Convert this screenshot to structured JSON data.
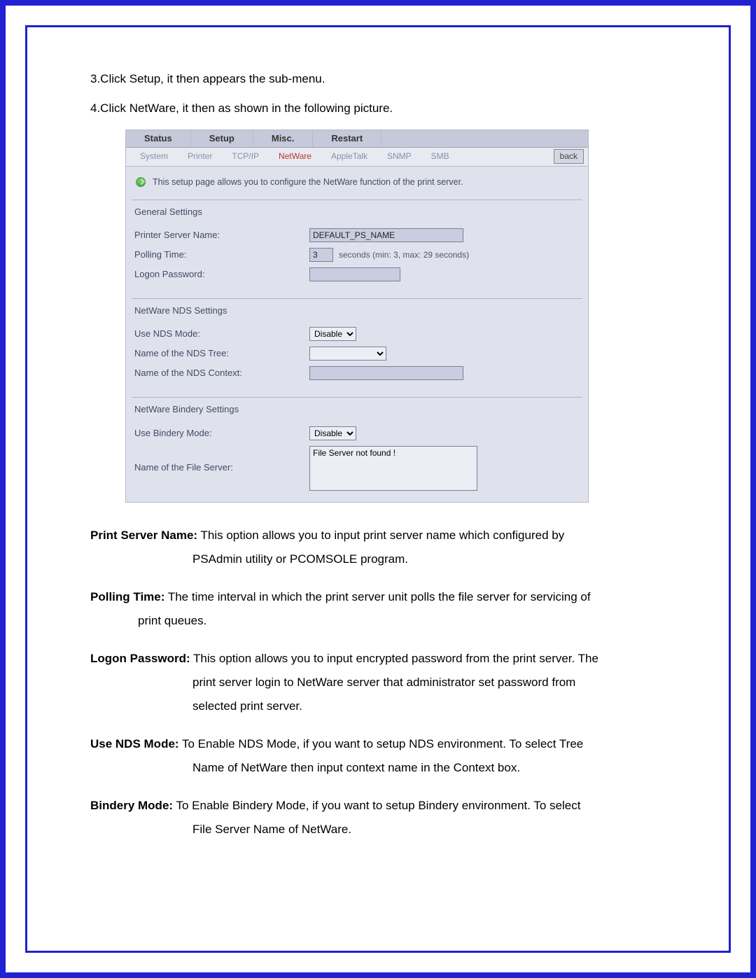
{
  "steps": {
    "s3": "3.Click Setup, it then appears the sub-menu.",
    "s4": "4.Click NetWare, it then as shown in the following picture."
  },
  "ui": {
    "tabs": {
      "status": "Status",
      "setup": "Setup",
      "misc": "Misc.",
      "restart": "Restart"
    },
    "subtabs": {
      "system": "System",
      "printer": "Printer",
      "tcpip": "TCP/IP",
      "netware": "NetWare",
      "appletalk": "AppleTalk",
      "snmp": "SNMP",
      "smb": "SMB"
    },
    "back": "back",
    "desc": "This setup page allows you to configure the NetWare function of the print server.",
    "general": {
      "title": "General Settings",
      "ps_name_label": "Printer Server Name:",
      "ps_name_value": "DEFAULT_PS_NAME",
      "polling_label": "Polling Time:",
      "polling_value": "3",
      "polling_hint": "seconds (min: 3, max: 29 seconds)",
      "logon_label": "Logon Password:",
      "logon_value": ""
    },
    "nds": {
      "title": "NetWare NDS Settings",
      "use_label": "Use NDS Mode:",
      "use_value": "Disable",
      "tree_label": "Name of the NDS Tree:",
      "tree_value": "",
      "ctx_label": "Name of the NDS Context:",
      "ctx_value": ""
    },
    "bindery": {
      "title": "NetWare Bindery Settings",
      "use_label": "Use Bindery Mode:",
      "use_value": "Disable",
      "fs_label": "Name of the File Server:",
      "fs_value": "File Server not found !"
    }
  },
  "defs": {
    "ps_name": {
      "label": "Print Server Name:",
      "l1": " This option allows you to input print server name which configured by",
      "l2": "PSAdmin utility or PCOMSOLE program."
    },
    "polling": {
      "label": "Polling Time:",
      "l1": " The time interval in which the print server unit polls the file server for servicing of",
      "l2": "print queues."
    },
    "logon": {
      "label": "Logon Password:",
      "l1": " This option allows you to input encrypted password from the print server. The",
      "l2": "print server login to NetWare server that administrator set password from",
      "l3": "selected print server."
    },
    "nds": {
      "label": "Use NDS Mode:",
      "l1": " To Enable NDS Mode, if you want to setup NDS environment. To select Tree",
      "l2": "Name of NetWare then input context name in the Context box."
    },
    "bindery": {
      "label": "Bindery Mode:",
      "l1": " To Enable Bindery Mode, if you want to setup Bindery environment. To select",
      "l2": "File Server Name of NetWare."
    }
  }
}
